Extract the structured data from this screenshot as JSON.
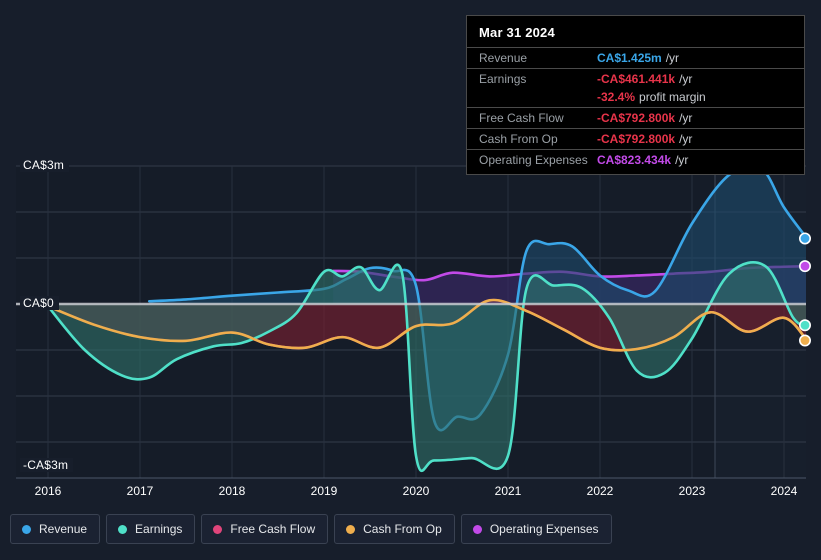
{
  "chart_data": {
    "type": "area",
    "title": "",
    "xlabel": "",
    "ylabel": "",
    "currency": "CA$",
    "x_ticks": [
      "2016",
      "2017",
      "2018",
      "2019",
      "2020",
      "2021",
      "2022",
      "2023",
      "2024"
    ],
    "y_ticks": [
      "CA$3m",
      "CA$0",
      "-CA$3m"
    ],
    "ylim": [
      -3.6,
      3.6
    ],
    "xlim": [
      2016,
      2024.5
    ],
    "grid": true,
    "legend_position": "bottom",
    "forecast_divider_x": 2023.25,
    "series": [
      {
        "name": "Revenue",
        "color": "#3aa6e8",
        "fill": "#1d4a6b",
        "x": [
          2017.1,
          2017.5,
          2018.0,
          2018.5,
          2019.0,
          2019.25,
          2019.5,
          2019.75,
          2020.0,
          2020.2,
          2020.45,
          2020.7,
          2021.0,
          2021.2,
          2021.45,
          2021.7,
          2022.0,
          2022.3,
          2022.6,
          2023.0,
          2023.4,
          2023.75,
          2024.0,
          2024.25
        ],
        "values": [
          0.06,
          0.1,
          0.18,
          0.25,
          0.33,
          0.55,
          0.78,
          0.72,
          0.4,
          -2.55,
          -2.45,
          -2.4,
          -1.1,
          1.15,
          1.3,
          1.25,
          0.62,
          0.3,
          0.28,
          1.75,
          2.8,
          2.95,
          2.1,
          1.425
        ]
      },
      {
        "name": "Earnings",
        "color": "#4fe0c8",
        "fill": "#2f6f68",
        "x": [
          2016.0,
          2016.4,
          2016.8,
          2017.1,
          2017.4,
          2017.8,
          2018.1,
          2018.4,
          2018.7,
          2019.0,
          2019.2,
          2019.4,
          2019.6,
          2019.85,
          2020.0,
          2020.2,
          2020.6,
          2021.0,
          2021.2,
          2021.5,
          2021.8,
          2022.1,
          2022.4,
          2022.7,
          2023.0,
          2023.4,
          2023.8,
          2024.1,
          2024.25
        ],
        "values": [
          -0.05,
          -1.0,
          -1.55,
          -1.6,
          -1.2,
          -0.92,
          -0.85,
          -0.6,
          -0.2,
          0.7,
          0.6,
          0.8,
          0.3,
          0.66,
          -3.3,
          -3.4,
          -3.35,
          -3.3,
          0.33,
          0.4,
          0.35,
          -0.3,
          -1.45,
          -1.5,
          -0.75,
          0.65,
          0.82,
          -0.3,
          -0.461441
        ]
      },
      {
        "name": "Free Cash Flow",
        "color": "#e0457b",
        "fill": "#7a2030",
        "x": [
          2016.0,
          2016.5,
          2017.0,
          2017.5,
          2018.0,
          2018.4,
          2018.8,
          2019.2,
          2019.6,
          2020.0,
          2020.4,
          2020.8,
          2021.2,
          2021.6,
          2022.0,
          2022.4,
          2022.8,
          2023.2,
          2023.6,
          2024.0,
          2024.25
        ],
        "values": [
          -0.05,
          -0.45,
          -0.72,
          -0.8,
          -0.62,
          -0.88,
          -0.95,
          -0.72,
          -0.95,
          -0.48,
          -0.42,
          0.08,
          -0.15,
          -0.55,
          -0.95,
          -0.98,
          -0.72,
          -0.18,
          -0.6,
          -0.3,
          -0.7928
        ]
      },
      {
        "name": "Cash From Op",
        "color": "#efae4d",
        "fill": "#7a2030",
        "x": [
          2016.0,
          2016.5,
          2017.0,
          2017.5,
          2018.0,
          2018.4,
          2018.8,
          2019.2,
          2019.6,
          2020.0,
          2020.4,
          2020.8,
          2021.2,
          2021.6,
          2022.0,
          2022.4,
          2022.8,
          2023.2,
          2023.6,
          2024.0,
          2024.25
        ],
        "values": [
          -0.05,
          -0.45,
          -0.72,
          -0.8,
          -0.62,
          -0.88,
          -0.95,
          -0.72,
          -0.95,
          -0.48,
          -0.42,
          0.08,
          -0.15,
          -0.55,
          -0.95,
          -0.98,
          -0.72,
          -0.18,
          -0.6,
          -0.3,
          -0.7928
        ]
      },
      {
        "name": "Operating Expenses",
        "color": "#c24ae8",
        "fill": "#3b2a6b",
        "x": [
          2019.1,
          2019.4,
          2019.8,
          2020.1,
          2020.4,
          2020.8,
          2021.2,
          2021.6,
          2022.0,
          2022.4,
          2022.8,
          2023.2,
          2023.6,
          2024.0,
          2024.25
        ],
        "values": [
          0.72,
          0.7,
          0.58,
          0.52,
          0.68,
          0.6,
          0.66,
          0.7,
          0.6,
          0.62,
          0.66,
          0.7,
          0.78,
          0.81,
          0.823434
        ]
      }
    ]
  },
  "tooltip": {
    "date": "Mar 31 2024",
    "rows": [
      {
        "label": "Revenue",
        "value": "CA$1.425m",
        "suffix": "/yr",
        "color": "#3aa6e8"
      },
      {
        "label": "Earnings",
        "value": "-CA$461.441k",
        "suffix": "/yr",
        "color": "#e8344a"
      },
      {
        "label": "",
        "value": "-32.4%",
        "suffix": "profit margin",
        "color": "#e8344a"
      },
      {
        "label": "Free Cash Flow",
        "value": "-CA$792.800k",
        "suffix": "/yr",
        "color": "#e8344a"
      },
      {
        "label": "Cash From Op",
        "value": "-CA$792.800k",
        "suffix": "/yr",
        "color": "#e8344a"
      },
      {
        "label": "Operating Expenses",
        "value": "CA$823.434k",
        "suffix": "/yr",
        "color": "#c24ae8"
      }
    ]
  },
  "legend": {
    "items": [
      {
        "label": "Revenue",
        "color": "#3aa6e8"
      },
      {
        "label": "Earnings",
        "color": "#4fe0c8"
      },
      {
        "label": "Free Cash Flow",
        "color": "#e0457b"
      },
      {
        "label": "Cash From Op",
        "color": "#efae4d"
      },
      {
        "label": "Operating Expenses",
        "color": "#c24ae8"
      }
    ]
  },
  "axes": {
    "y_labels": [
      {
        "text": "CA$3m",
        "value": 3
      },
      {
        "text": "CA$0",
        "value": 0
      },
      {
        "text": "-CA$3m",
        "value": -3
      }
    ],
    "x_labels": [
      "2016",
      "2017",
      "2018",
      "2019",
      "2020",
      "2021",
      "2022",
      "2023",
      "2024"
    ]
  }
}
